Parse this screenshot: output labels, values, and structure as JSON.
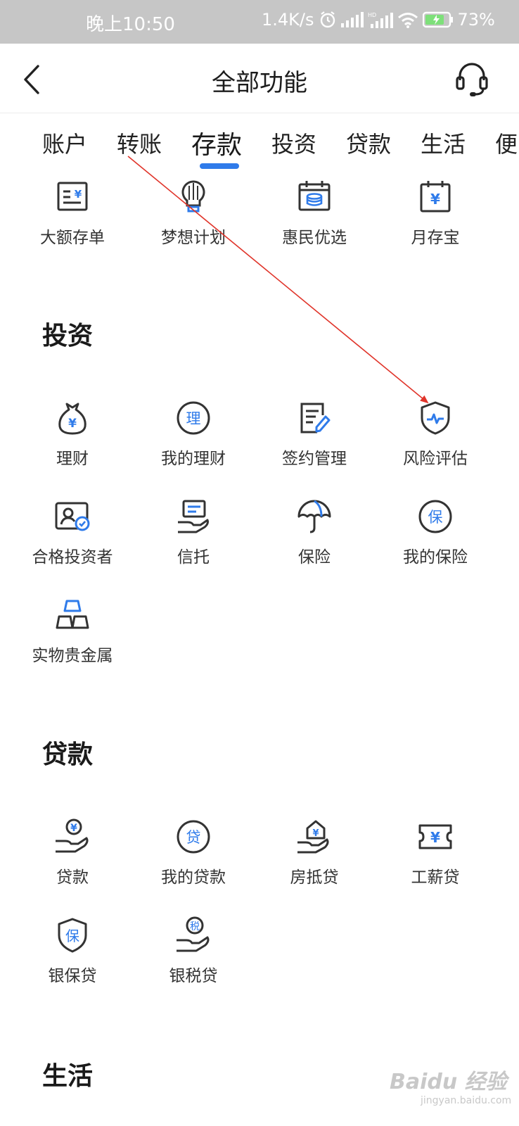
{
  "status_bar": {
    "time": "晚上10:50",
    "speed": "1.4K/s",
    "battery": "73%"
  },
  "header": {
    "title": "全部功能",
    "back_icon": "chevron-left-icon",
    "service_icon": "headset-icon"
  },
  "tabs": [
    {
      "label": "账户"
    },
    {
      "label": "转账"
    },
    {
      "label": "存款",
      "active": true
    },
    {
      "label": "投资"
    },
    {
      "label": "贷款"
    },
    {
      "label": "生活"
    },
    {
      "label": "便"
    }
  ],
  "deposit_items": [
    {
      "label": "大额存单",
      "icon": "certificate-yen-icon"
    },
    {
      "label": "梦想计划",
      "icon": "lightbulb-icon"
    },
    {
      "label": "惠民优选",
      "icon": "calendar-coins-icon"
    },
    {
      "label": "月存宝",
      "icon": "calendar-yen-icon"
    }
  ],
  "investment": {
    "title": "投资",
    "items": [
      {
        "label": "理财",
        "icon": "money-bag-icon"
      },
      {
        "label": "我的理财",
        "icon": "li-badge-icon",
        "glyph": "理"
      },
      {
        "label": "签约管理",
        "icon": "document-pen-icon"
      },
      {
        "label": "风险评估",
        "icon": "shield-pulse-icon"
      },
      {
        "label": "合格投资者",
        "icon": "id-card-check-icon"
      },
      {
        "label": "信托",
        "icon": "hand-card-icon"
      },
      {
        "label": "保险",
        "icon": "umbrella-icon"
      },
      {
        "label": "我的保险",
        "icon": "bao-badge-icon",
        "glyph": "保"
      },
      {
        "label": "实物贵金属",
        "icon": "gold-bars-icon"
      }
    ]
  },
  "loans": {
    "title": "贷款",
    "items": [
      {
        "label": "贷款",
        "icon": "hand-yen-icon"
      },
      {
        "label": "我的贷款",
        "icon": "dai-badge-icon",
        "glyph": "贷"
      },
      {
        "label": "房抵贷",
        "icon": "house-hand-icon"
      },
      {
        "label": "工薪贷",
        "icon": "ticket-yen-icon"
      },
      {
        "label": "银保贷",
        "icon": "shield-bao-icon",
        "glyph": "保"
      },
      {
        "label": "银税贷",
        "icon": "hand-tax-icon",
        "glyph": "税"
      }
    ]
  },
  "life": {
    "title": "生活"
  },
  "colors": {
    "accent": "#2f7bea",
    "icon_stroke": "#333333",
    "annotation": "#e0342a"
  }
}
